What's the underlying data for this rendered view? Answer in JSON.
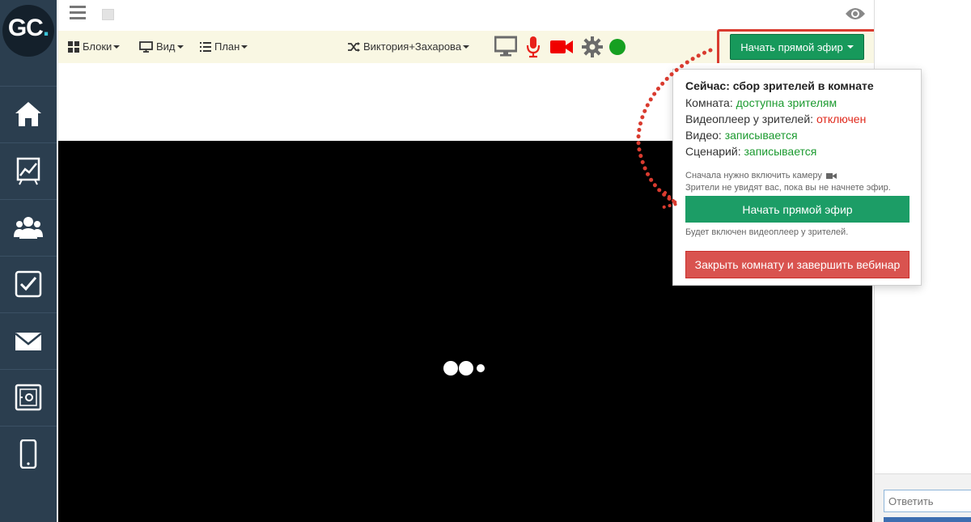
{
  "logo": {
    "text": "GC",
    "dot": "."
  },
  "toolbar": {
    "blocks_label": "Блоки",
    "view_label": "Вид",
    "plan_label": "План",
    "scenario_label": "Виктория+Захарова",
    "status_color": "#16a021"
  },
  "live_button": {
    "label": "Начать прямой эфир"
  },
  "popup": {
    "title": "Сейчас: сбор зрителей в комнате",
    "room_label": "Комната:",
    "room_value": "доступна зрителям",
    "player_label": "Видеоплеер у зрителей:",
    "player_value": "отключен",
    "video_label": "Видео:",
    "video_value": "записывается",
    "script_label": "Сценарий:",
    "script_value": "записывается",
    "hint_camera": "Сначала нужно включить камеру",
    "hint_viewers": "Зрители не увидят вас, пока вы не начнете эфир.",
    "start_button": "Начать прямой эфир",
    "hint_player": "Будет включен видеоплеер у зрителей.",
    "close_button": "Закрыть комнату и завершить вебинар"
  },
  "reply": {
    "placeholder": "Ответить"
  },
  "colors": {
    "sidebar": "#2b3e4f",
    "toolbar_bg": "#f9f7e3",
    "live_green": "#17995b",
    "danger_red": "#d9534f",
    "highlight_red": "#d93b2f",
    "status_green": "#1b9a2f",
    "status_red": "#e02a1d"
  },
  "sidebar_icons": [
    "home-icon",
    "presentation-chart-icon",
    "users-icon",
    "checkbox-icon",
    "mail-icon",
    "safe-icon",
    "mobile-icon"
  ]
}
